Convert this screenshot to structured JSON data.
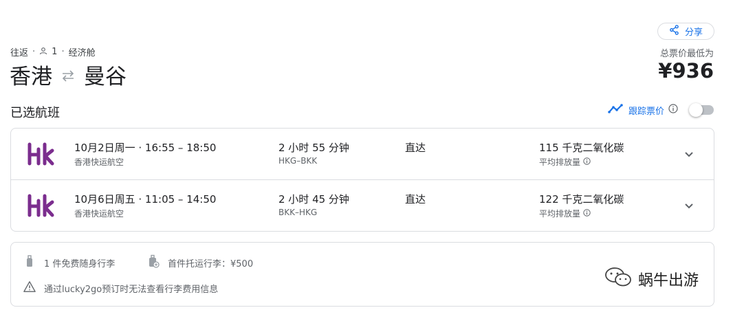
{
  "header": {
    "share_label": "分享",
    "trip_type": "往返",
    "passengers": "1",
    "cabin": "经济舱",
    "origin": "香港",
    "destination": "曼谷",
    "price_label": "总票价最低为",
    "price": "¥936"
  },
  "selected": {
    "title": "已选航班",
    "track_label": "跟踪票价"
  },
  "flights": [
    {
      "date_time": "10月2日周一 · 16:55 – 18:50",
      "airline": "香港快运航空",
      "duration": "2 小时 55 分钟",
      "route_codes": "HKG–BKK",
      "stops": "直达",
      "emissions": "115 千克二氧化碳",
      "emissions_label": "平均排放量"
    },
    {
      "date_time": "10月6日周五 · 11:05 – 14:50",
      "airline": "香港快运航空",
      "duration": "2 小时 45 分钟",
      "route_codes": "BKK–HKG",
      "stops": "直达",
      "emissions": "122 千克二氧化碳",
      "emissions_label": "平均排放量"
    }
  ],
  "baggage": {
    "carry_on": "1 件免费随身行李",
    "checked": "首件托运行李：¥500",
    "notice": "通过lucky2go预订时无法查看行李费用信息"
  },
  "watermark": "蜗牛出游",
  "colors": {
    "accent": "#1a73e8",
    "logo": "#7b2d8e",
    "border": "#dadce0",
    "muted": "#5f6368"
  }
}
